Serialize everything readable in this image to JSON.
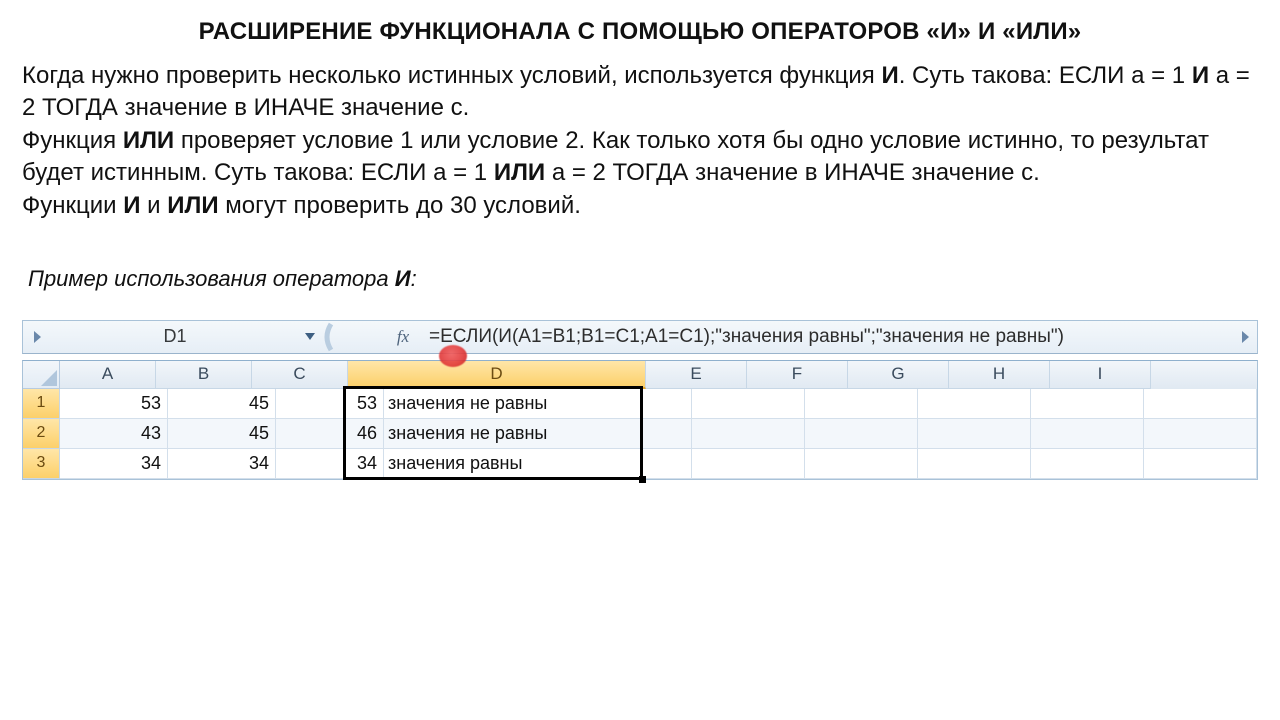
{
  "title": "РАСШИРЕНИЕ ФУНКЦИОНАЛА С ПОМОЩЬЮ ОПЕРАТОРОВ «И» И «ИЛИ»",
  "paragraph": {
    "p1a": "Когда нужно проверить несколько истинных условий, используется функция ",
    "p1and": "И",
    "p1b": ". Суть такова: ЕСЛИ а = 1 ",
    "p1and2": "И",
    "p1c": " а = 2 ТОГДА значение в ИНАЧЕ значение с.",
    "p2a": "Функция ",
    "p2or": "ИЛИ",
    "p2b": " проверяет условие 1 или условие 2. Как только хотя бы одно условие истинно, то результат будет истинным. Суть такова: ЕСЛИ а = 1 ",
    "p2or2": "ИЛИ",
    "p2c": " а = 2 ТОГДА значение в ИНАЧЕ значение с.",
    "p3a": "Функции ",
    "p3and": "И",
    "p3m": " и ",
    "p3or": "ИЛИ",
    "p3b": " могут проверить до 30 условий."
  },
  "example_caption_a": "Пример использования оператора ",
  "example_caption_b": "И",
  "example_caption_c": ":",
  "excel": {
    "name_box": "D1",
    "fx_label": "fx",
    "formula": "=ЕСЛИ(И(A1=B1;B1=C1;A1=C1);\"значения равны\";\"значения не равны\")",
    "columns": [
      "A",
      "B",
      "C",
      "D",
      "E",
      "F",
      "G",
      "H",
      "I"
    ],
    "rows": [
      {
        "n": "1",
        "A": "53",
        "B": "45",
        "C": "53",
        "D": "значения не равны"
      },
      {
        "n": "2",
        "A": "43",
        "B": "45",
        "C": "46",
        "D": "значения не равны"
      },
      {
        "n": "3",
        "A": "34",
        "B": "34",
        "C": "34",
        "D": "значения равны"
      }
    ],
    "selected_col": "D"
  }
}
